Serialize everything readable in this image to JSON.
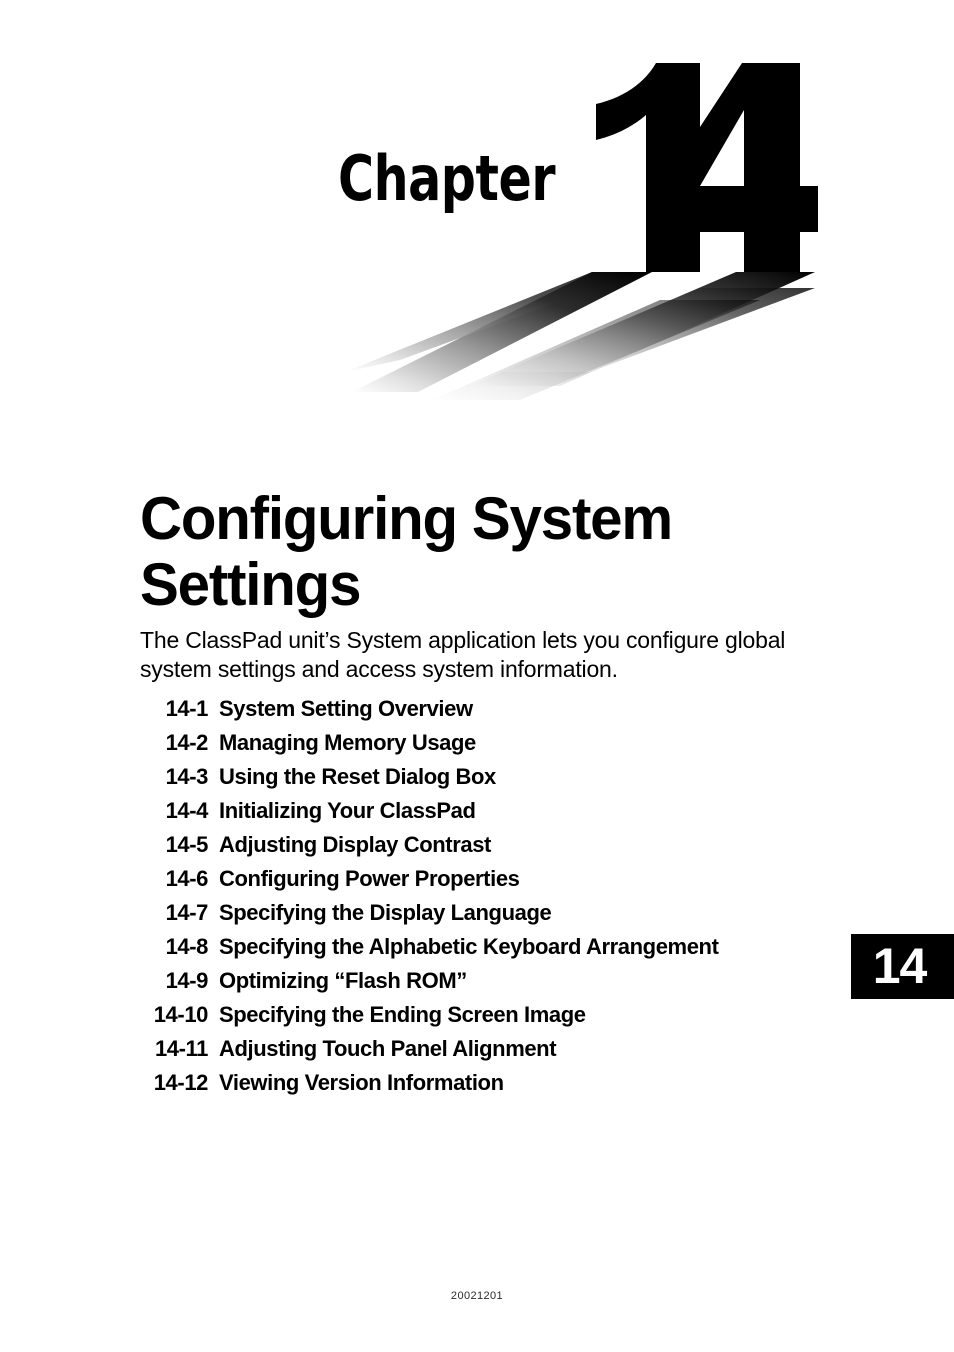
{
  "page": {
    "footer_text": "20021201",
    "background_color": "#ffffff",
    "text_color": "#000000"
  },
  "chapter_header": {
    "word": "Chapter",
    "number": "14",
    "shadow": "perspective-drop-shadow"
  },
  "title_block": {
    "title_line_1": "Configuring System",
    "title_line_2": "Settings",
    "intro": "The ClassPad unit’s System application lets you configure global system settings and access system information."
  },
  "toc": {
    "entries": [
      {
        "number": "14-1",
        "label": "System Setting Overview"
      },
      {
        "number": "14-2",
        "label": "Managing Memory Usage"
      },
      {
        "number": "14-3",
        "label": "Using the Reset Dialog Box"
      },
      {
        "number": "14-4",
        "label": "Initializing Your ClassPad"
      },
      {
        "number": "14-5",
        "label": "Adjusting Display Contrast"
      },
      {
        "number": "14-6",
        "label": "Configuring Power Properties"
      },
      {
        "number": "14-7",
        "label": "Specifying the Display Language"
      },
      {
        "number": "14-8",
        "label": "Specifying the Alphabetic Keyboard Arrangement"
      },
      {
        "number": "14-9",
        "label": "Optimizing “Flash ROM”"
      },
      {
        "number": "14-10",
        "label": "Specifying the Ending Screen Image"
      },
      {
        "number": "14-11",
        "label": "Adjusting Touch Panel Alignment"
      },
      {
        "number": "14-12",
        "label": "Viewing Version Information"
      }
    ]
  },
  "chapter_tab": {
    "label": "14",
    "background_color": "#000000",
    "text_color": "#ffffff"
  }
}
